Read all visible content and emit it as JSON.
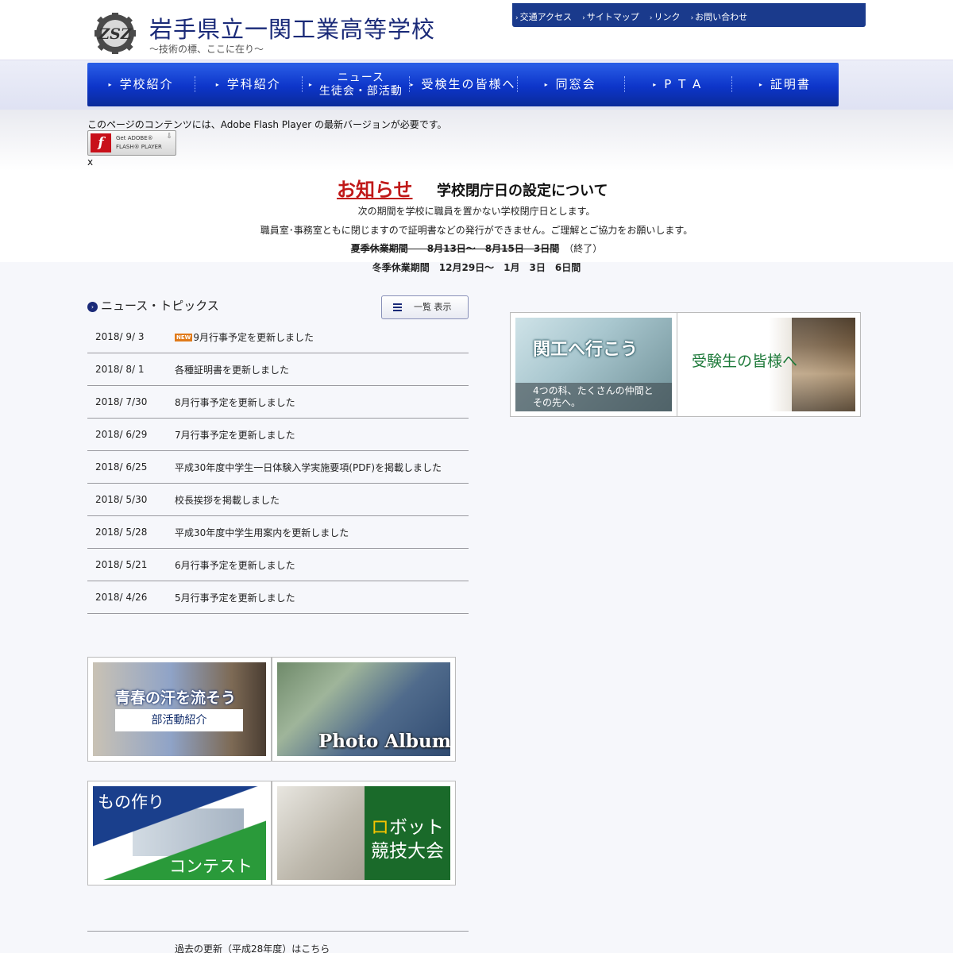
{
  "header": {
    "title": "岩手県立一関工業高等学校",
    "tagline": "〜技術の標、ここに在り〜",
    "utility_links": [
      "交通アクセス",
      "サイトマップ",
      "リンク",
      "お問い合わせ"
    ]
  },
  "nav": {
    "items": [
      {
        "label": "学校紹介"
      },
      {
        "label": "学科紹介"
      },
      {
        "label_line1": "ニュース",
        "label_line2": "生徒会・部活動"
      },
      {
        "label": "受検生の皆様へ"
      },
      {
        "label": "同窓会"
      },
      {
        "label": "P T A"
      },
      {
        "label": "証明書"
      }
    ]
  },
  "flash": {
    "message": "このページのコンテンツには、Adobe Flash Player の最新バージョンが必要です。",
    "badge_line1": "Get ADOBE®",
    "badge_line2": "FLASH® PLAYER",
    "close": "x"
  },
  "notice": {
    "label": "お知らせ",
    "title": "学校閉庁日の設定について",
    "line1": "次の期間を学校に職員を置かない学校閉庁日とします。",
    "line2": "職員室･事務室ともに閉じますので証明書などの発行ができません。ご理解とご協力をお願いします。",
    "summer": "夏季休業期間　　8月13日〜　8月15日　3日間",
    "summer_status": "（終了）",
    "winter": "冬季休業期間　12月29日〜　1月　3日　6日間"
  },
  "news": {
    "heading": "ニュース・トピックス",
    "list_button": "一覧 表示",
    "new_badge": "NEW",
    "items": [
      {
        "date": "2018/ 9/ 3",
        "title": "9月行事予定を更新しました"
      },
      {
        "date": "2018/ 8/ 1",
        "title": "各種証明書を更新しました"
      },
      {
        "date": "2018/ 7/30",
        "title": "8月行事予定を更新しました"
      },
      {
        "date": "2018/ 6/29",
        "title": "7月行事予定を更新しました"
      },
      {
        "date": "2018/ 6/25",
        "title": "平成30年度中学生一日体験入学実施要項(PDF)を掲載しました"
      },
      {
        "date": "2018/ 5/30",
        "title": "校長挨拶を掲載しました"
      },
      {
        "date": "2018/ 5/28",
        "title": "平成30年度中学生用案内を更新しました"
      },
      {
        "date": "2018/ 5/21",
        "title": "6月行事予定を更新しました"
      },
      {
        "date": "2018/ 4/26",
        "title": "5月行事予定を更新しました"
      }
    ],
    "past_link": "過去の更新（平成28年度）はこちら"
  },
  "banners": {
    "kanko": {
      "title": "関工へ行こう",
      "sub_line1": "4つの科、たくさんの仲間と",
      "sub_line2": "その先へ。"
    },
    "exam": {
      "title": "受験生の皆様へ"
    },
    "club": {
      "title": "青春の汗を流そう",
      "sub": "部活動紹介"
    },
    "photo": {
      "title": "Photo Album"
    },
    "mono": {
      "title_top": "もの作り",
      "title_bottom": "コンテスト"
    },
    "robot": {
      "title_hl": "ロ",
      "title_rest": "ボット",
      "title_line2": "競技大会"
    }
  },
  "colors": {
    "brand_blue": "#1a3a8c",
    "nav_blue": "#0d35c9",
    "notice_red": "#c01818",
    "new_badge": "#e07a1a"
  }
}
